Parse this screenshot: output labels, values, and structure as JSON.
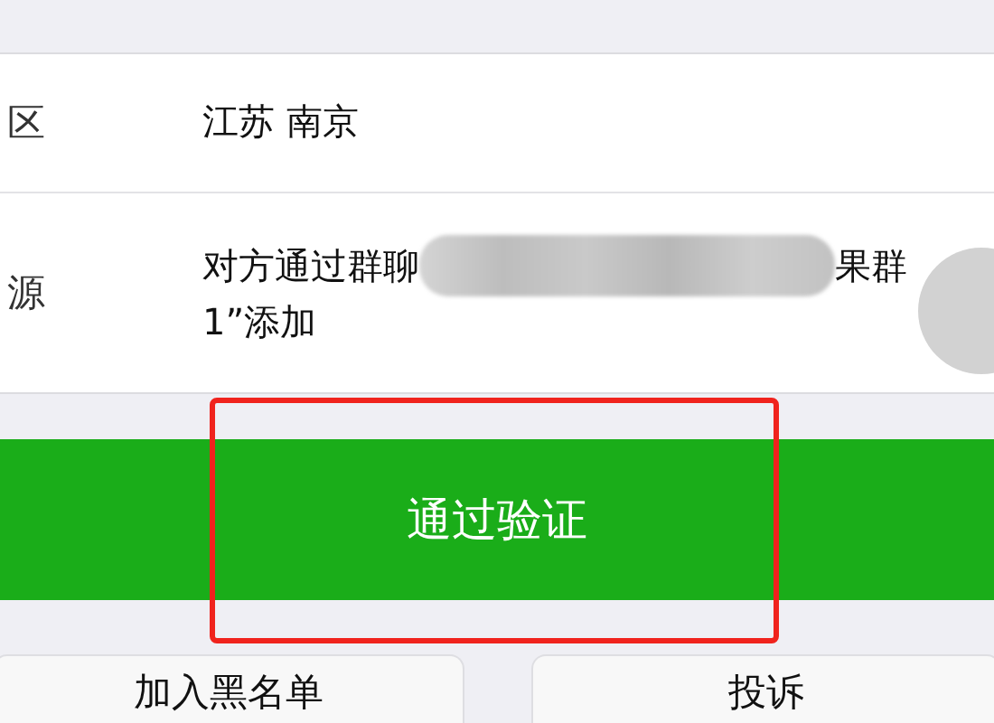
{
  "info_rows": [
    {
      "label": "区",
      "lines": [
        [
          {
            "kind": "text",
            "text": "江苏 南京"
          }
        ]
      ]
    },
    {
      "label": "源",
      "lines": [
        [
          {
            "kind": "text",
            "text": "对方通过群聊"
          },
          {
            "kind": "blur"
          },
          {
            "kind": "text",
            "text": "果群"
          }
        ],
        [
          {
            "kind": "text",
            "text": "1”添加"
          }
        ]
      ]
    }
  ],
  "verify_button": {
    "label": "通过验证",
    "highlighted": true
  },
  "bottom_buttons": [
    "加入黑名单",
    "投诉"
  ]
}
